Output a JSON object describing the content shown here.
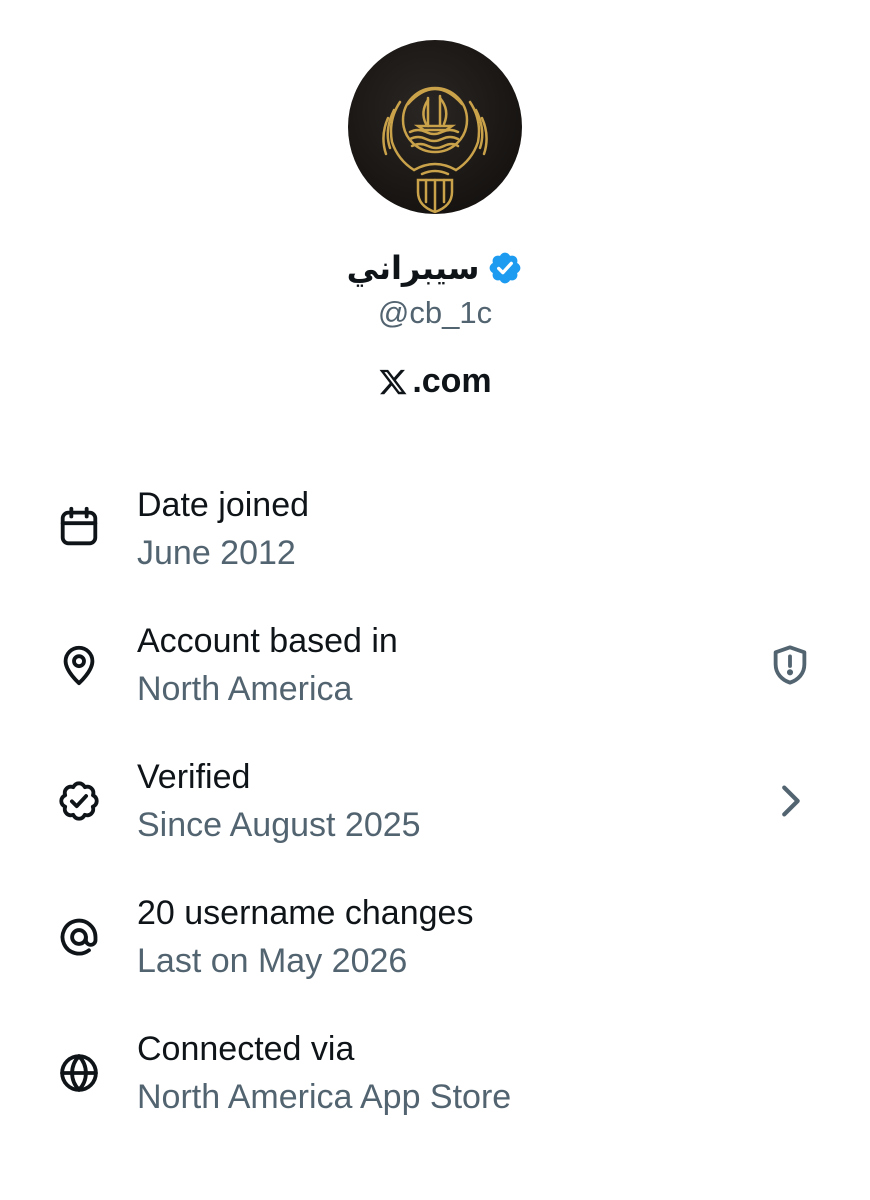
{
  "profile": {
    "display_name": "سيبراني",
    "handle": "@cb_1c",
    "site": ".com",
    "site_logo_icon": "x-logo-icon",
    "verified_icon": "verified-badge-icon",
    "avatar_icon": "kuwait-emblem-icon"
  },
  "colors": {
    "primary_text": "#0f1419",
    "secondary_text": "#536471",
    "verified_blue": "#1d9bf0",
    "avatar_gold": "#c9a24a"
  },
  "rows": [
    {
      "title": "Date joined",
      "subtitle": "June 2012",
      "icon": "calendar-icon"
    },
    {
      "title": "Account based in",
      "subtitle": "North America",
      "icon": "location-pin-icon",
      "action_icon": "shield-alert-icon"
    },
    {
      "title": "Verified",
      "subtitle": "Since August 2025",
      "icon": "verified-outline-icon",
      "action_icon": "chevron-right-icon"
    },
    {
      "title": "20 username changes",
      "subtitle": "Last on May 2026",
      "icon": "at-sign-icon"
    },
    {
      "title": "Connected via",
      "subtitle": "North America App Store",
      "icon": "globe-icon"
    }
  ]
}
